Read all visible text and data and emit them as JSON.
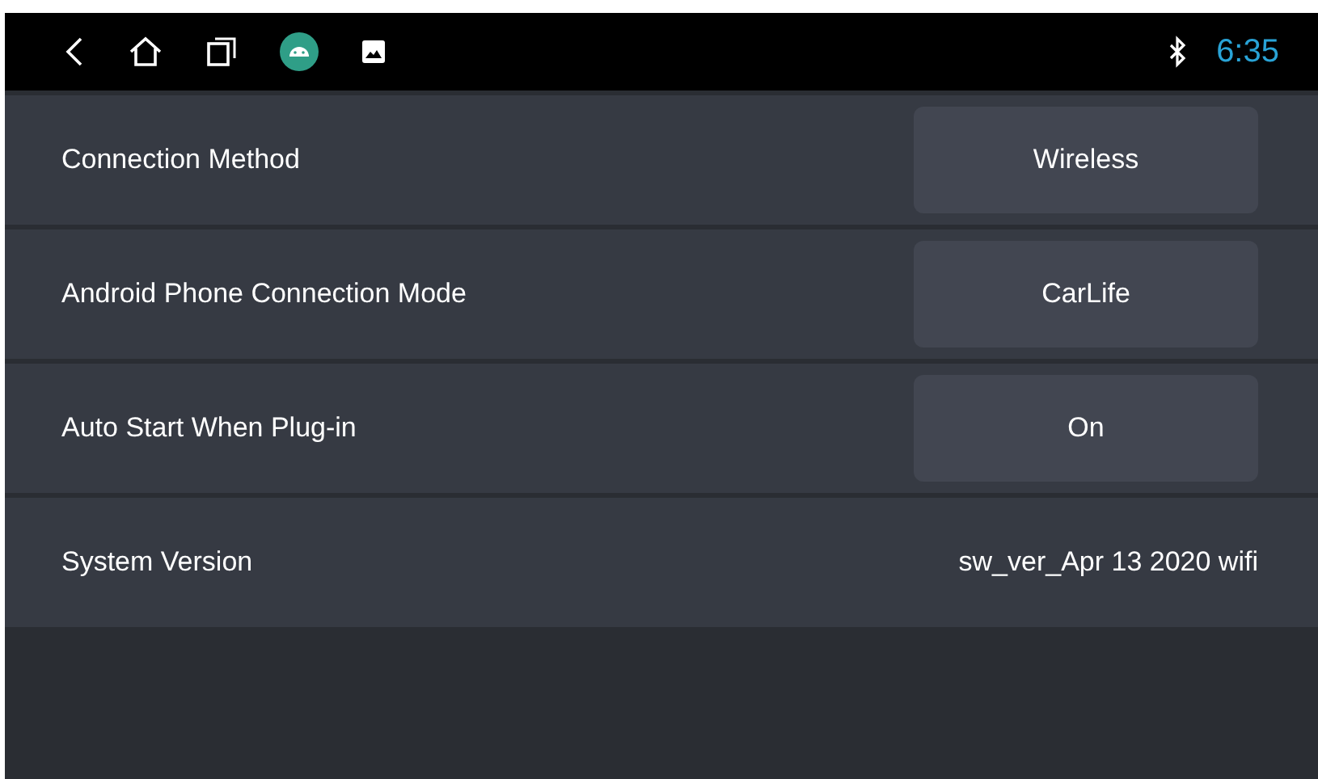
{
  "status_bar": {
    "time": "6:35"
  },
  "settings": [
    {
      "label": "Connection Method",
      "value": "Wireless",
      "kind": "button"
    },
    {
      "label": "Android Phone Connection Mode",
      "value": "CarLife",
      "kind": "button"
    },
    {
      "label": "Auto Start When Plug-in",
      "value": "On",
      "kind": "button"
    },
    {
      "label": "System Version",
      "value": "sw_ver_Apr 13 2020 wifi",
      "kind": "text"
    }
  ]
}
